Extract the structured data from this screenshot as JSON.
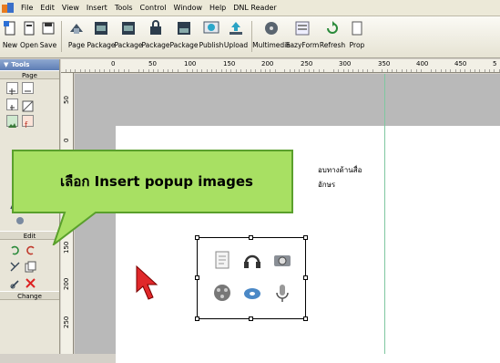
{
  "menubar": {
    "items": [
      "File",
      "Edit",
      "View",
      "Insert",
      "Tools",
      "Control",
      "Window",
      "Help",
      "DNL Reader"
    ]
  },
  "toolbar": {
    "buttons": [
      "New",
      "Open",
      "Save",
      "Page",
      "Package",
      "Package",
      "Package",
      "Package",
      "Publish",
      "Upload",
      "Multimedia",
      "EazyForm",
      "Refresh",
      "Prop"
    ]
  },
  "left_panel": {
    "header": "Tools",
    "page_label": "Page",
    "edit_label": "Edit",
    "change_label": "Change"
  },
  "ruler": {
    "top_ticks": [
      "0",
      "50",
      "100",
      "150",
      "200",
      "250",
      "300",
      "350",
      "400",
      "450",
      "5"
    ],
    "left_ticks": [
      "50",
      "0",
      "150",
      "200",
      "250"
    ]
  },
  "page": {
    "text_line1": "อบทางด้านสื่อ",
    "text_line2": "อักษร"
  },
  "popup_images": {
    "captions": [
      "",
      "",
      "",
      "",
      "",
      ""
    ]
  },
  "callout": {
    "text": "เลือก Insert popup images",
    "fill_color": "#a8e063",
    "border_color": "#5aa02c"
  },
  "accent": {
    "selection_border": "#000000",
    "guide_line": "#7fc7a0",
    "cursor_red": "#e0282a"
  }
}
